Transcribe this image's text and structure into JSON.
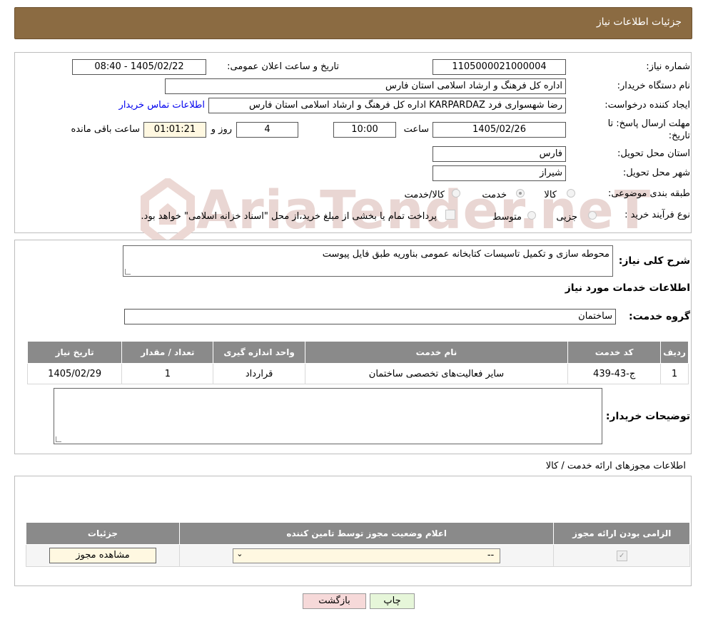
{
  "header": {
    "title": "جزئیات اطلاعات نیاز"
  },
  "form": {
    "need_number_label": "شماره نیاز:",
    "need_number": "1105000021000004",
    "announce_label": "تاریخ و ساعت اعلان عمومی:",
    "announce_value": "1405/02/22 - 08:40",
    "buyer_org_label": "نام دستگاه خریدار:",
    "buyer_org": "اداره کل فرهنگ و ارشاد اسلامی استان فارس",
    "requester_label": "ایجاد کننده درخواست:",
    "requester": "رضا شهسواری فرد KARPARDAZ اداره کل فرهنگ و ارشاد اسلامی استان فارس",
    "contact_link": "اطلاعات تماس خریدار",
    "deadline_label": "مهلت ارسال پاسخ: تا تاریخ:",
    "deadline_date": "1405/02/26",
    "time_label": "ساعت",
    "deadline_time": "10:00",
    "days_value": "4",
    "days_label": "روز و",
    "remaining_time": "01:01:21",
    "remaining_label": "ساعت باقی مانده",
    "province_label": "استان محل تحویل:",
    "province": "فارس",
    "city_label": "شهر محل تحویل:",
    "city": "شیراز",
    "category_label": "طبقه بندی موضوعی:",
    "category_options": [
      "کالا",
      "خدمت",
      "کالا/خدمت"
    ],
    "category_selected": "خدمت",
    "process_label": "نوع فرآیند خرید :",
    "process_options": [
      "جزیی",
      "متوسط"
    ],
    "payment_note": "پرداخت تمام یا بخشی از مبلغ خرید،از محل \"اسناد خزانه اسلامی\" خواهد بود."
  },
  "description": {
    "label": "شرح کلی نیاز:",
    "text": "محوطه سازی و تکمیل تاسیسات کتابخانه عمومی بناوریه طبق فایل پیوست",
    "services_title": "اطلاعات خدمات مورد نیاز",
    "group_label": "گروه خدمت:",
    "group_value": "ساختمان"
  },
  "services_table": {
    "headers": [
      "ردیف",
      "کد خدمت",
      "نام خدمت",
      "واحد اندازه گیری",
      "تعداد / مقدار",
      "تاریخ نیاز"
    ],
    "rows": [
      [
        "1",
        "ج-43-439",
        "سایر فعالیت‌های تخصصی ساختمان",
        "قرارداد",
        "1",
        "1405/02/29"
      ]
    ]
  },
  "buyer_notes": {
    "label": "توضیحات خریدار:",
    "text": ""
  },
  "licenses": {
    "title": "اطلاعات مجوزهای ارائه خدمت / کالا",
    "headers": [
      "الزامی بودن ارائه مجوز",
      "اعلام وضعیت مجوز توسط تامین کننده",
      "جزئیات"
    ],
    "select_value": "--",
    "view_button": "مشاهده مجوز",
    "required_checked": true
  },
  "buttons": {
    "print": "چاپ",
    "back": "بازگشت"
  },
  "watermark": {
    "text": "AriaTender.neT"
  },
  "colors": {
    "header_bg": "#8b6b42",
    "table_header": "#8a8a8a",
    "link": "#0000ee",
    "back_button_bg": "#f6d9d9",
    "print_button_bg": "#e6f6d9"
  }
}
